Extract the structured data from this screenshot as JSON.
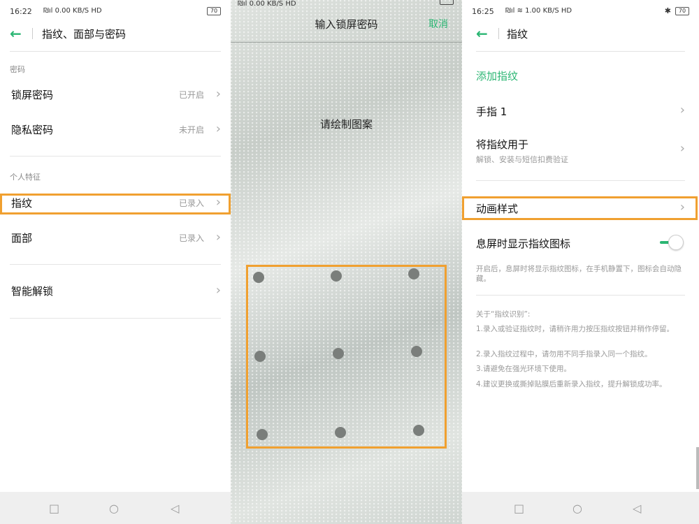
{
  "panel1": {
    "status": {
      "time": "16:22",
      "net": "₪ıl 0.00 KB/S HD",
      "battery": "70"
    },
    "header": {
      "title": "指纹、面部与密码"
    },
    "section_password": "密码",
    "rows_password": [
      {
        "label": "锁屏密码",
        "value": "已开启"
      },
      {
        "label": "隐私密码",
        "value": "未开启"
      }
    ],
    "section_personal": "个人特征",
    "rows_personal": [
      {
        "label": "指纹",
        "value": "已录入"
      },
      {
        "label": "面部",
        "value": "已录入"
      }
    ],
    "smart_unlock": {
      "label": "智能解锁"
    }
  },
  "panel2": {
    "status": {
      "net": "₪ıl 0.00 KB/S HD"
    },
    "title": "输入锁屏密码",
    "cancel": "取消",
    "prompt": "请绘制图案"
  },
  "panel3": {
    "status": {
      "time": "16:25",
      "net": "₪ıl ≋ 1.00 KB/S HD",
      "battery": "70",
      "bluetooth": "✱"
    },
    "header": {
      "title": "指纹"
    },
    "add_fingerprint": "添加指纹",
    "finger1": {
      "label": "手指 1"
    },
    "use_for": {
      "label": "将指纹用于",
      "sub": "解锁、安装与短信扣费验证"
    },
    "animation": {
      "label": "动画样式"
    },
    "screen_off_icon": {
      "label": "息屏时显示指纹图标",
      "enabled": true
    },
    "screen_off_desc": "开启后，息屏时将显示指纹图标，在手机静置下，图标会自动隐藏。",
    "about_title": "关于“指纹识别”:",
    "about_items": [
      "1.录入或验证指纹时，请稍许用力按压指纹按钮并稍作停留。",
      "2.录入指纹过程中，请勿用不同手指录入同一个指纹。",
      "3.请避免在强光环境下使用。",
      "4.建议更换或撕掉贴膜后重新录入指纹，提升解锁成功率。"
    ]
  },
  "navbar": {
    "icons": [
      "square-icon",
      "circle-icon",
      "triangle-back-icon"
    ]
  },
  "colors": {
    "accent": "#2bb673",
    "highlight": "#f0a030"
  }
}
